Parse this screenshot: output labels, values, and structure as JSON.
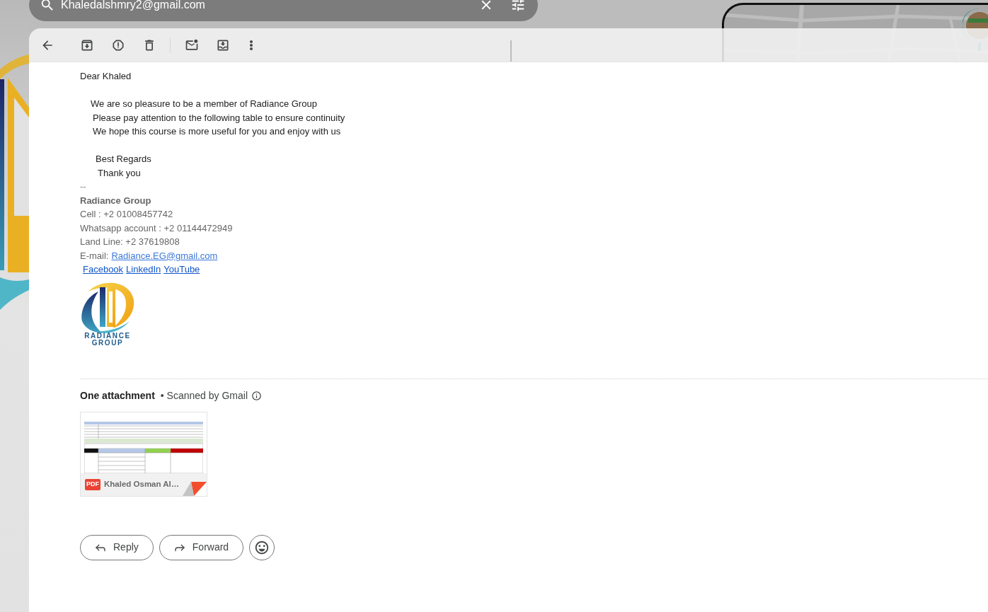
{
  "search": {
    "value": "Khaledalshmry2@gmail.com"
  },
  "message": {
    "greeting": "Dear Khaled",
    "paragraphs": [
      "We are so pleasure to be a member of Radiance Group",
      "Please pay attention to the following table to ensure continuity",
      "We hope this course is more useful for you and enjoy with us"
    ],
    "closing": [
      "Best Regards",
      "Thank you"
    ]
  },
  "signature": {
    "separator": "--",
    "name": "Radiance Group",
    "lines": [
      "Cell : +2 01008457742",
      "Whatsapp account : +2 01144472949",
      "Land Line: +2 37619808"
    ],
    "email": {
      "label": "E-mail:",
      "link": "Radiance.EG@gmail.com"
    },
    "links": [
      "Facebook",
      "LinkedIn",
      "YouTube"
    ],
    "logo_text": [
      "RADIANCE",
      "GROUP"
    ]
  },
  "attachments": {
    "title": "One attachment",
    "scan_note": "• Scanned by Gmail",
    "files": [
      {
        "type": "PDF",
        "name": "Khaled Osman Al…"
      }
    ]
  },
  "actions": [
    {
      "kind": "reply",
      "label": "Reply"
    },
    {
      "kind": "forward",
      "label": "Forward"
    }
  ]
}
